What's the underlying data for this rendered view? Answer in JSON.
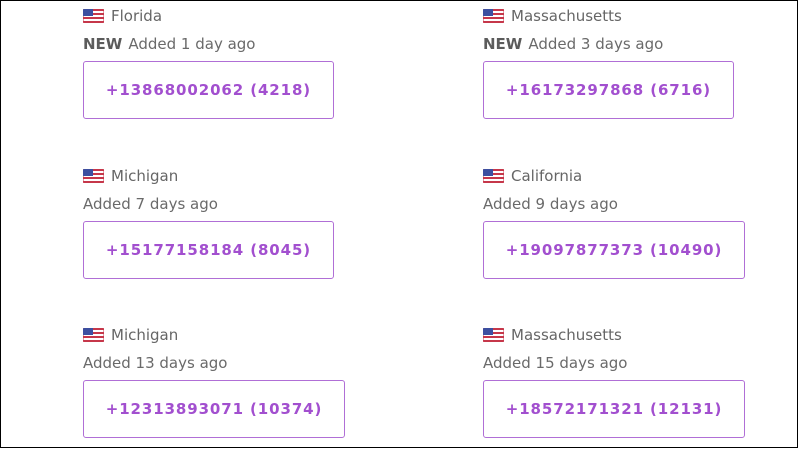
{
  "numbers": [
    {
      "state": "Florida",
      "badge": "NEW",
      "added": "Added 1 day ago",
      "number": "+13868002062 (4218)"
    },
    {
      "state": "Massachusetts",
      "badge": "NEW",
      "added": "Added 3 days ago",
      "number": "+16173297868 (6716)"
    },
    {
      "state": "Michigan",
      "badge": "",
      "added": "Added 7 days ago",
      "number": "+15177158184 (8045)"
    },
    {
      "state": "California",
      "badge": "",
      "added": "Added 9 days ago",
      "number": "+19097877373 (10490)"
    },
    {
      "state": "Michigan",
      "badge": "",
      "added": "Added 13 days ago",
      "number": "+12313893071 (10374)"
    },
    {
      "state": "Massachusetts",
      "badge": "",
      "added": "Added 15 days ago",
      "number": "+18572171321 (12131)"
    }
  ],
  "icons": {
    "flag": "us-flag-icon"
  },
  "colors": {
    "accent": "#a24fcf",
    "border": "#b06fd6",
    "text": "#666666"
  }
}
